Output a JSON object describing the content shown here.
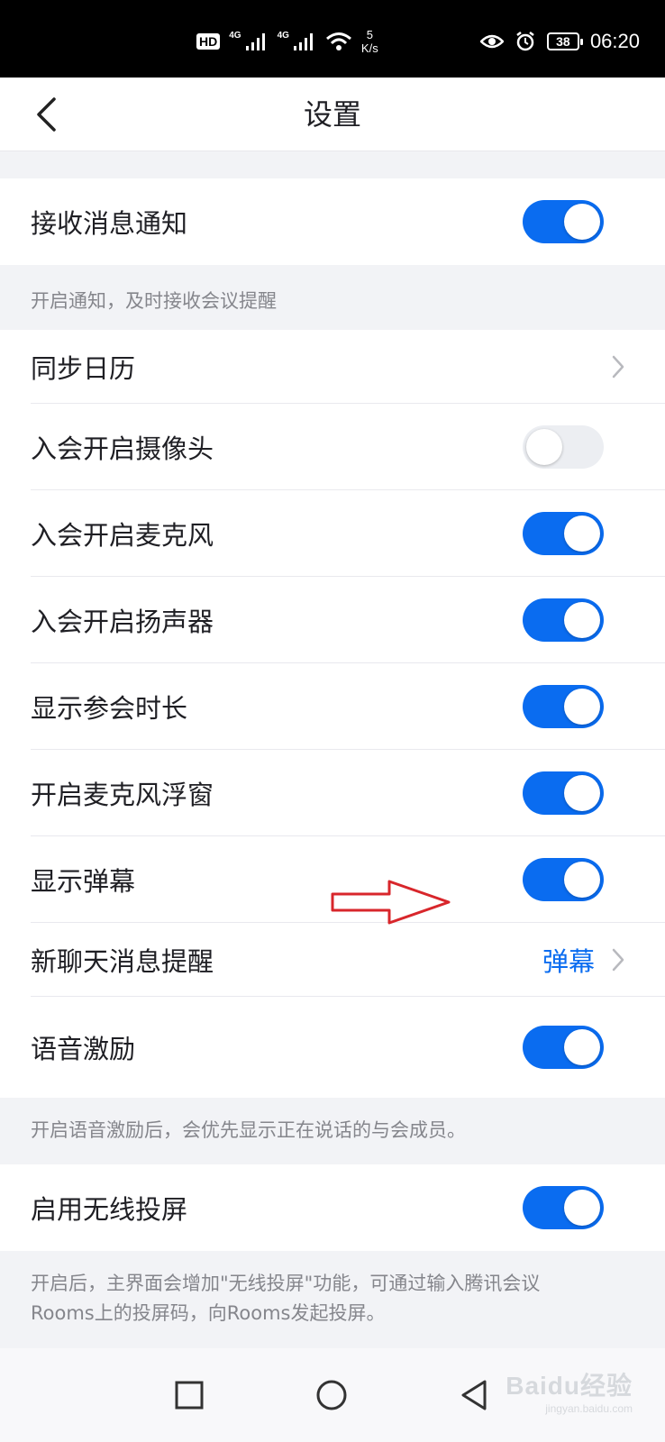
{
  "status_bar": {
    "hd": "HD",
    "net1": "4G",
    "net2": "4G",
    "speed_value": "5",
    "speed_unit": "K/s",
    "battery": "38",
    "time": "06:20"
  },
  "header": {
    "title": "设置"
  },
  "settings": {
    "receive_notifications": {
      "label": "接收消息通知",
      "enabled": true
    },
    "notifications_hint": "开启通知，及时接收会议提醒",
    "sync_calendar": {
      "label": "同步日历"
    },
    "camera_on_join": {
      "label": "入会开启摄像头",
      "enabled": false
    },
    "mic_on_join": {
      "label": "入会开启麦克风",
      "enabled": true
    },
    "speaker_on_join": {
      "label": "入会开启扬声器",
      "enabled": true
    },
    "show_duration": {
      "label": "显示参会时长",
      "enabled": true
    },
    "mic_float_window": {
      "label": "开启麦克风浮窗",
      "enabled": true
    },
    "show_danmaku": {
      "label": "显示弹幕",
      "enabled": true
    },
    "new_chat_alert": {
      "label": "新聊天消息提醒",
      "value": "弹幕"
    },
    "voice_excitation": {
      "label": "语音激励",
      "enabled": true
    },
    "voice_excitation_hint": "开启语音激励后，会优先显示正在说话的与会成员。",
    "wireless_cast": {
      "label": "启用无线投屏",
      "enabled": true
    },
    "wireless_cast_hint_line1": "开启后，主界面会增加\"无线投屏\"功能，可通过输入腾讯会议",
    "wireless_cast_hint_line2": "Rooms上的投屏码，向Rooms发起投屏。"
  },
  "watermark": {
    "main": "Baidu经验",
    "sub": "jingyan.baidu.com"
  },
  "colors": {
    "accent": "#0a6cf0",
    "toggle_off": "#eceef2",
    "annotation_arrow": "#d8262b"
  }
}
